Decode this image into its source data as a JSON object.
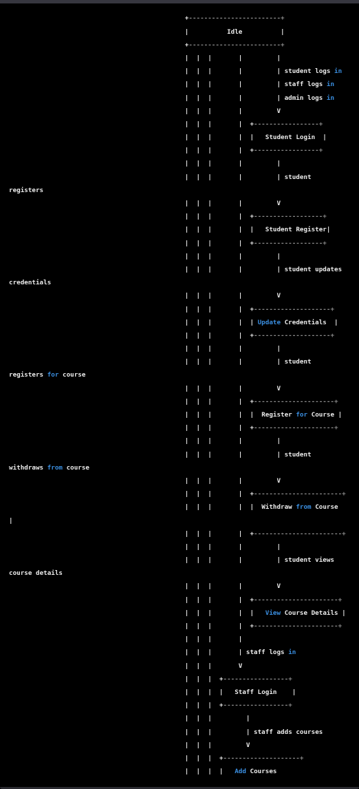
{
  "diagram": {
    "title": "Idle",
    "theme": {
      "background": "#000000",
      "text": "#ececec",
      "keyword": "#3a8ee0",
      "border_dashes": "#8a8a8a"
    },
    "keywords": [
      "in",
      "for",
      "from",
      "Update",
      "View",
      "Add"
    ],
    "lines": [
      {
        "indent": true,
        "text": "+------------------------+"
      },
      {
        "indent": true,
        "text": "|          Idle          |"
      },
      {
        "indent": true,
        "text": "+------------------------+"
      },
      {
        "indent": true,
        "text": "|  |  |       |         |"
      },
      {
        "indent": true,
        "text": "|  |  |       |         | student logs in"
      },
      {
        "indent": true,
        "text": "|  |  |       |         | staff logs in"
      },
      {
        "indent": true,
        "text": "|  |  |       |         | admin logs in"
      },
      {
        "indent": true,
        "text": "|  |  |       |         V"
      },
      {
        "indent": true,
        "text": "|  |  |       |  +-----------------+"
      },
      {
        "indent": true,
        "text": "|  |  |       |  |   Student Login  |"
      },
      {
        "indent": true,
        "text": "|  |  |       |  +-----------------+"
      },
      {
        "indent": true,
        "text": "|  |  |       |         |"
      },
      {
        "indent": true,
        "text": "|  |  |       |         | student"
      },
      {
        "indent": false,
        "text": "registers"
      },
      {
        "indent": true,
        "text": "|  |  |       |         V"
      },
      {
        "indent": true,
        "text": "|  |  |       |  +------------------+"
      },
      {
        "indent": true,
        "text": "|  |  |       |  |   Student Register|"
      },
      {
        "indent": true,
        "text": "|  |  |       |  +------------------+"
      },
      {
        "indent": true,
        "text": "|  |  |       |         |"
      },
      {
        "indent": true,
        "text": "|  |  |       |         | student updates"
      },
      {
        "indent": false,
        "text": "credentials"
      },
      {
        "indent": true,
        "text": "|  |  |       |         V"
      },
      {
        "indent": true,
        "text": "|  |  |       |  +--------------------+"
      },
      {
        "indent": true,
        "text": "|  |  |       |  | Update Credentials  |"
      },
      {
        "indent": true,
        "text": "|  |  |       |  +--------------------+"
      },
      {
        "indent": true,
        "text": "|  |  |       |         |"
      },
      {
        "indent": true,
        "text": "|  |  |       |         | student"
      },
      {
        "indent": false,
        "text": "registers for course"
      },
      {
        "indent": true,
        "text": "|  |  |       |         V"
      },
      {
        "indent": true,
        "text": "|  |  |       |  +---------------------+"
      },
      {
        "indent": true,
        "text": "|  |  |       |  |  Register for Course |"
      },
      {
        "indent": true,
        "text": "|  |  |       |  +---------------------+"
      },
      {
        "indent": true,
        "text": "|  |  |       |         |"
      },
      {
        "indent": true,
        "text": "|  |  |       |         | student"
      },
      {
        "indent": false,
        "text": "withdraws from course"
      },
      {
        "indent": true,
        "text": "|  |  |       |         V"
      },
      {
        "indent": true,
        "text": "|  |  |       |  +-----------------------+"
      },
      {
        "indent": true,
        "text": "|  |  |       |  |  Withdraw from Course"
      },
      {
        "indent": false,
        "text": "|"
      },
      {
        "indent": true,
        "text": "|  |  |       |  +-----------------------+"
      },
      {
        "indent": true,
        "text": "|  |  |       |         |"
      },
      {
        "indent": true,
        "text": "|  |  |       |         | student views"
      },
      {
        "indent": false,
        "text": "course details"
      },
      {
        "indent": true,
        "text": "|  |  |       |         V"
      },
      {
        "indent": true,
        "text": "|  |  |       |  +----------------------+"
      },
      {
        "indent": true,
        "text": "|  |  |       |  |   View Course Details |"
      },
      {
        "indent": true,
        "text": "|  |  |       |  +----------------------+"
      },
      {
        "indent": true,
        "text": "|  |  |       |"
      },
      {
        "indent": true,
        "text": "|  |  |       | staff logs in"
      },
      {
        "indent": true,
        "text": "|  |  |       V"
      },
      {
        "indent": true,
        "text": "|  |  |  +-----------------+"
      },
      {
        "indent": true,
        "text": "|  |  |  |   Staff Login    |"
      },
      {
        "indent": true,
        "text": "|  |  |  +-----------------+"
      },
      {
        "indent": true,
        "text": "|  |  |         |"
      },
      {
        "indent": true,
        "text": "|  |  |         | staff adds courses"
      },
      {
        "indent": true,
        "text": "|  |  |         V"
      },
      {
        "indent": true,
        "text": "|  |  |  +--------------------+"
      },
      {
        "indent": true,
        "text": "|  |  |  |   Add Courses"
      }
    ]
  }
}
